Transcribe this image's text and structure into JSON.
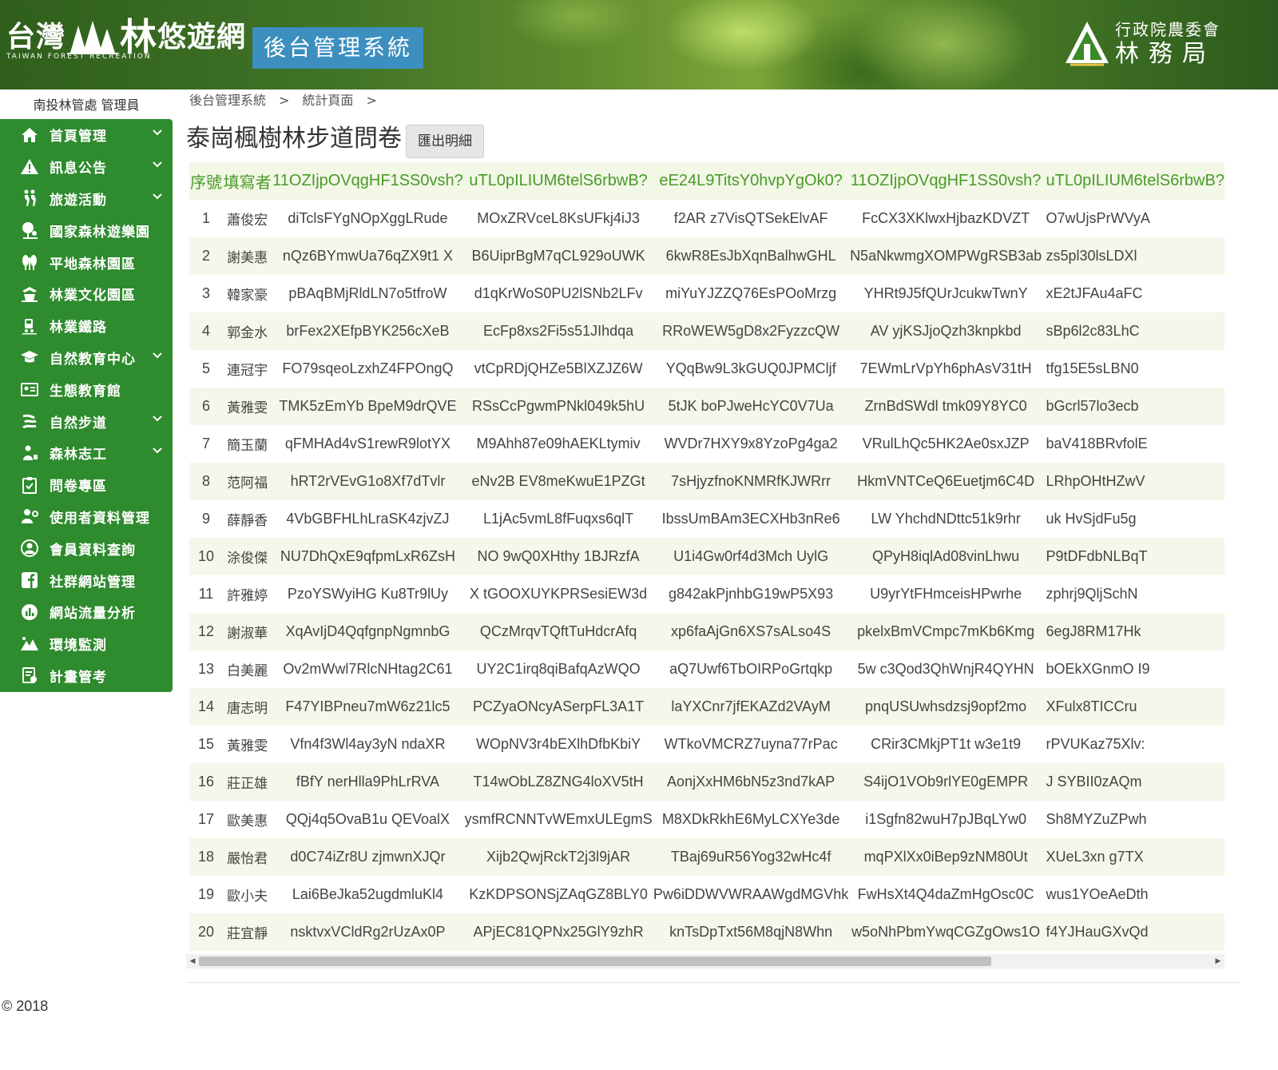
{
  "header": {
    "logo_text_a": "台灣",
    "logo_text_b": "林",
    "logo_text_c": "悠遊網",
    "logo_sub": "TAIWAN   FOREST   RECREATION",
    "system_title": "後台管理系統",
    "agency_line1": "行政院農委會",
    "agency_line2": "林務局",
    "brand_green": "#2e8b2e",
    "title_blue": "#3d8fbf"
  },
  "user_label": "南投林管處 管理員",
  "sidebar": {
    "items": [
      {
        "label": "首頁管理",
        "icon": "home-icon",
        "expandable": true
      },
      {
        "label": "訊息公告",
        "icon": "warning-icon",
        "expandable": true
      },
      {
        "label": "旅遊活動",
        "icon": "hiking-icon",
        "expandable": true
      },
      {
        "label": "國家森林遊樂園",
        "icon": "tree-park-icon",
        "expandable": false
      },
      {
        "label": "平地森林園區",
        "icon": "forest-icon",
        "expandable": false
      },
      {
        "label": "林業文化園區",
        "icon": "culture-icon",
        "expandable": false
      },
      {
        "label": "林業鐵路",
        "icon": "train-icon",
        "expandable": false
      },
      {
        "label": "自然教育中心",
        "icon": "graduation-cap-icon",
        "expandable": true
      },
      {
        "label": "生態教育館",
        "icon": "museum-icon",
        "expandable": false
      },
      {
        "label": "自然步道",
        "icon": "trail-icon",
        "expandable": true
      },
      {
        "label": "森林志工",
        "icon": "volunteer-icon",
        "expandable": true
      },
      {
        "label": "問卷專區",
        "icon": "clipboard-check-icon",
        "expandable": false
      },
      {
        "label": "使用者資料管理",
        "icon": "user-settings-icon",
        "expandable": false
      },
      {
        "label": "會員資料查詢",
        "icon": "member-icon",
        "expandable": false
      },
      {
        "label": "社群網站管理",
        "icon": "facebook-icon",
        "expandable": false
      },
      {
        "label": "網站流量分析",
        "icon": "chart-icon",
        "expandable": false
      },
      {
        "label": "環境監測",
        "icon": "mountain-icon",
        "expandable": false
      },
      {
        "label": "計畫管考",
        "icon": "plan-icon",
        "expandable": false
      }
    ]
  },
  "breadcrumb": {
    "items": [
      "後台管理系統",
      "統計頁面"
    ],
    "separator": ">"
  },
  "page": {
    "title": "泰崗楓樹林步道問卷",
    "export_label": "匯出明細"
  },
  "table": {
    "headers": [
      "序號",
      "填寫者",
      "11OZIjpOVqgHF1SS0vsh?",
      "uTL0pILIUM6telS6rbwB?",
      "eE24L9TitsY0hvpYgOk0?",
      "11OZIjpOVqgHF1SS0vsh?",
      "uTL0pILIUM6telS6rbwB?"
    ],
    "rows": [
      [
        "1",
        "蕭俊宏",
        "diTclsFYgNOpXggLRude",
        "MOxZRVceL8KsUFkj4iJ3",
        "f2AR z7VisQTSekElvAF",
        "FcCX3XKlwxHjbazKDVZT",
        "O7wUjsPrWVyA"
      ],
      [
        "2",
        "謝美惠",
        "nQz6BYmwUa76qZX9t1 X",
        "B6UiprBgM7qCL929oUWK",
        "6kwR8EsJbXqnBalhwGHL",
        "N5aNkwmgXOMPWgRSB3ab",
        "zs5pl30lsLDXl"
      ],
      [
        "3",
        "韓家豪",
        "pBAqBMjRldLN7o5tfroW",
        "d1qKrWoS0PU2lSNb2LFv",
        "miYuYJZZQ76EsPOoMrzg",
        "YHRt9J5fQUrJcukwTwnY",
        "xE2tJFAu4aFC"
      ],
      [
        "4",
        "郭金水",
        "brFex2XEfpBYK256cXeB",
        "EcFp8xs2Fi5s51JIhdqa",
        "RRoWEW5gD8x2FyzzcQW",
        "AV yjKSJjoQzh3knpkbd",
        "sBp6l2c83LhC"
      ],
      [
        "5",
        "連冠宇",
        "FO79sqeoLzxhZ4FPOngQ",
        "vtCpRDjQHZe5BlXZJZ6W",
        "YQqBw9L3kGUQ0JPMCljf",
        "7EWmLrVpYh6phAsV31tH",
        "tfg15E5sLBN0"
      ],
      [
        "6",
        "黃雅雯",
        "TMK5zEmYb BpeM9drQVE",
        "RSsCcPgwmPNkl049k5hU",
        "5tJK boPJweHcYC0V7Ua",
        "ZrnBdSWdl tmk09Y8YC0",
        "bGcrl57lo3ecb"
      ],
      [
        "7",
        "簡玉蘭",
        "qFMHAd4vS1rewR9lotYX",
        "M9Ahh87e09hAEKLtymiv",
        "WVDr7HXY9x8YzoPg4ga2",
        "VRulLhQc5HK2Ae0sxJZP",
        "baV418BRvfolE"
      ],
      [
        "8",
        "范阿福",
        "hRT2rVEvG1o8Xf7dTvlr",
        "eNv2B EV8meKwuE1PZGt",
        "7sHjyzfnoKNMRfKJWRrr",
        "HkmVNTCeQ6Euetjm6C4D",
        "LRhpOHtHZwV"
      ],
      [
        "9",
        "薛靜香",
        "4VbGBFHLhLraSK4zjvZJ",
        "L1jAc5vmL8fFuqxs6qlT",
        "IbssUmBAm3ECXHb3nRe6",
        "LW YhchdNDttc51k9rhr",
        "uk HvSjdFu5g"
      ],
      [
        "10",
        "涂俊傑",
        "NU7DhQxE9qfpmLxR6ZsH",
        "NO 9wQ0XHthy 1BJRzfA",
        "U1i4Gw0rf4d3Mch UylG",
        "QPyH8iqlAd08vinLhwu",
        "P9tDFdbNLBqT"
      ],
      [
        "11",
        "許雅婷",
        "PzoYSWyiHG Ku8Tr9lUy",
        "X tGOOXUYKPRSesiEW3d",
        "g842akPjnhbG19wP5X93",
        "U9yrYtFHmceisHPwrhe",
        "zphrj9QljSchN"
      ],
      [
        "12",
        "謝淑華",
        "XqAvIjD4QqfgnpNgmnbG",
        "QCzMrqvTQftTuHdcrAfq",
        "xp6faAjGn6XS7sALso4S",
        "pkelxBmVCmpc7mKb6Kmg",
        "6egJ8RM17Hk"
      ],
      [
        "13",
        "白美麗",
        "Ov2mWwl7RlcNHtag2C61",
        "UY2C1irq8qiBafqAzWQO",
        "aQ7Uwf6TbOIRPoGrtqkp",
        "5w c3Qod3QhWnjR4QYHN",
        "bOEkXGnmO I9"
      ],
      [
        "14",
        "唐志明",
        "F47YIBPneu7mW6z21lc5",
        "PCZyaONcyASerpFL3A1T",
        "laYXCnr7jfEKAZd2VAyM",
        "pnqUSUwhsdzsj9opf2mo",
        "XFulx8TICCru"
      ],
      [
        "15",
        "黃雅雯",
        "Vfn4f3Wl4ay3yN ndaXR",
        "WOpNV3r4bEXlhDfbKbiY",
        "WTkoVMCRZ7uyna77rPac",
        "CRir3CMkjPT1t w3e1t9",
        "rPVUKaz75Xlv:"
      ],
      [
        "16",
        "莊正雄",
        "fBfY nerHlla9PhLrRVA",
        "T14wObLZ8ZNG4loXV5tH",
        "AonjXxHM6bN5z3nd7kAP",
        "S4ijO1VOb9rlYE0gEMPR",
        "J SYBII0zAQm"
      ],
      [
        "17",
        "歐美惠",
        "QQj4q5OvaB1u QEVoalX",
        "ysmfRCNNTvWEmxULEgmS",
        "M8XDkRkhE6MyLCXYe3de",
        "i1Sgfn82wuH7pJBqLYw0",
        "Sh8MYZuZPwh"
      ],
      [
        "18",
        "嚴怡君",
        "d0C74iZr8U zjmwnXJQr",
        "Xijb2QwjRckT2j3l9jAR",
        "TBaj69uR56Yog32wHc4f",
        "mqPXlXx0iBep9zNM80Ut",
        "XUeL3xn g7TX"
      ],
      [
        "19",
        "歐小夫",
        "Lai6BeJka52ugdmluKl4",
        "KzKDPSONSjZAqGZ8BLY0",
        "Pw6iDDWVWRAAWgdMGVhk",
        "FwHsXt4Q4daZmHgOsc0C",
        "wus1YOeAeDth"
      ],
      [
        "20",
        "莊宜靜",
        "nsktvxVCldRg2rUzAx0P",
        "APjEC81QPNx25GlY9zhR",
        "knTsDpTxt56M8qjN8Whn",
        "w5oNhPbmYwqCGZgOws1O",
        "f4YJHauGXvQd"
      ]
    ]
  },
  "scrollbar": {
    "left_arrow": "◀",
    "right_arrow": "▶"
  },
  "footer": {
    "copyright": "© 2018"
  }
}
